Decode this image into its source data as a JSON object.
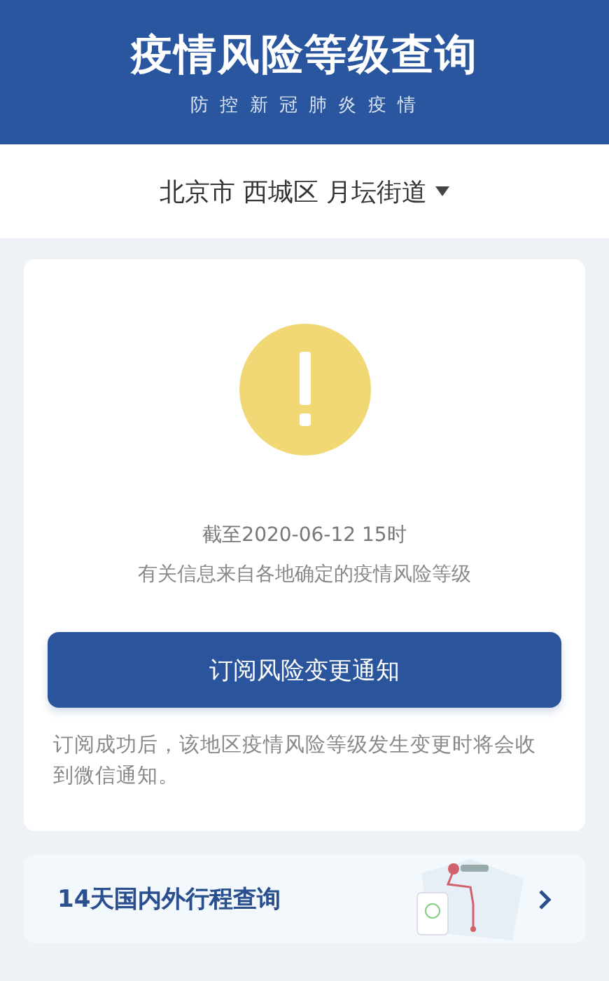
{
  "header": {
    "title": "疫情风险等级查询",
    "subtitle": "防 控 新 冠 肺 炎 疫 情"
  },
  "location": {
    "label": "北京市 西城区 月坛街道"
  },
  "status_card": {
    "updated": "截至2020-06-12 15时",
    "source_note": "有关信息来自各地确定的疫情风险等级",
    "subscribe_button": "订阅风险变更通知",
    "subscribe_note": "订阅成功后，该地区疫情风险等级发生变更时将会收到微信通知。"
  },
  "travel_card": {
    "label": "14天国内外行程查询"
  }
}
